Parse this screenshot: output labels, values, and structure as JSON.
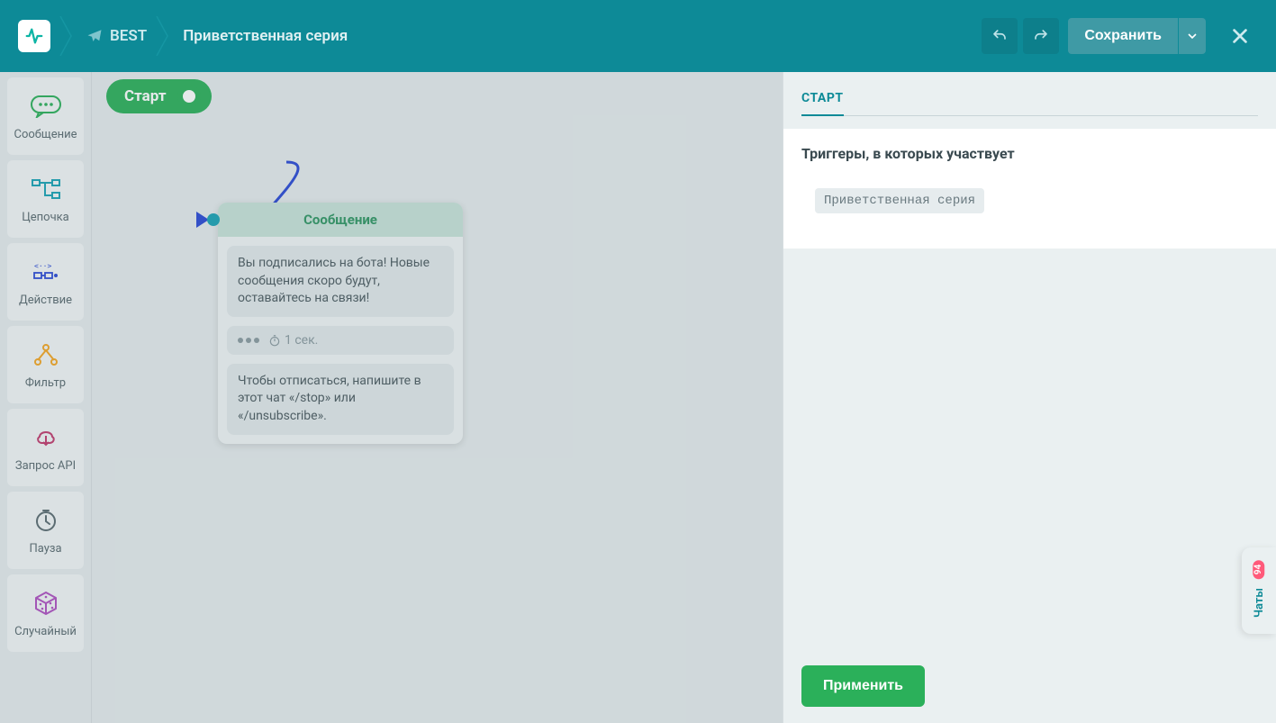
{
  "header": {
    "bot_name": "BEST",
    "flow_title": "Приветственная серия",
    "save_label": "Сохранить"
  },
  "toolbox": {
    "items": [
      {
        "label": "Сообщение",
        "icon": "message",
        "color": "#2bb05a"
      },
      {
        "label": "Цепочка",
        "icon": "chain",
        "color": "#1aa3b5"
      },
      {
        "label": "Действие",
        "icon": "action",
        "color": "#2a49d6"
      },
      {
        "label": "Фильтр",
        "icon": "filter",
        "color": "#f5a623"
      },
      {
        "label": "Запрос API",
        "icon": "api",
        "color": "#c23b6e"
      },
      {
        "label": "Пауза",
        "icon": "pause",
        "color": "#5a6a70"
      },
      {
        "label": "Случайный",
        "icon": "random",
        "color": "#b050c2"
      }
    ]
  },
  "canvas": {
    "start_label": "Старт",
    "message_node": {
      "title": "Сообщение",
      "bubbles": [
        "Вы подписались на бота! Новые сообщения скоро будут, оставайтесь на связи!",
        "Чтобы отписаться, напишите в этот чат «/stop» или «/unsubscribe»."
      ],
      "typing_delay": "1 сек."
    }
  },
  "panel": {
    "tab_label": "СТАРТ",
    "triggers_heading": "Триггеры, в которых участвует",
    "trigger_name": "Приветственная серия",
    "apply_label": "Применить"
  },
  "chats": {
    "label": "Чаты",
    "badge": "94"
  },
  "colors": {
    "teal": "#0d8a97",
    "green": "#2bb05a",
    "blue": "#2a49d6"
  }
}
